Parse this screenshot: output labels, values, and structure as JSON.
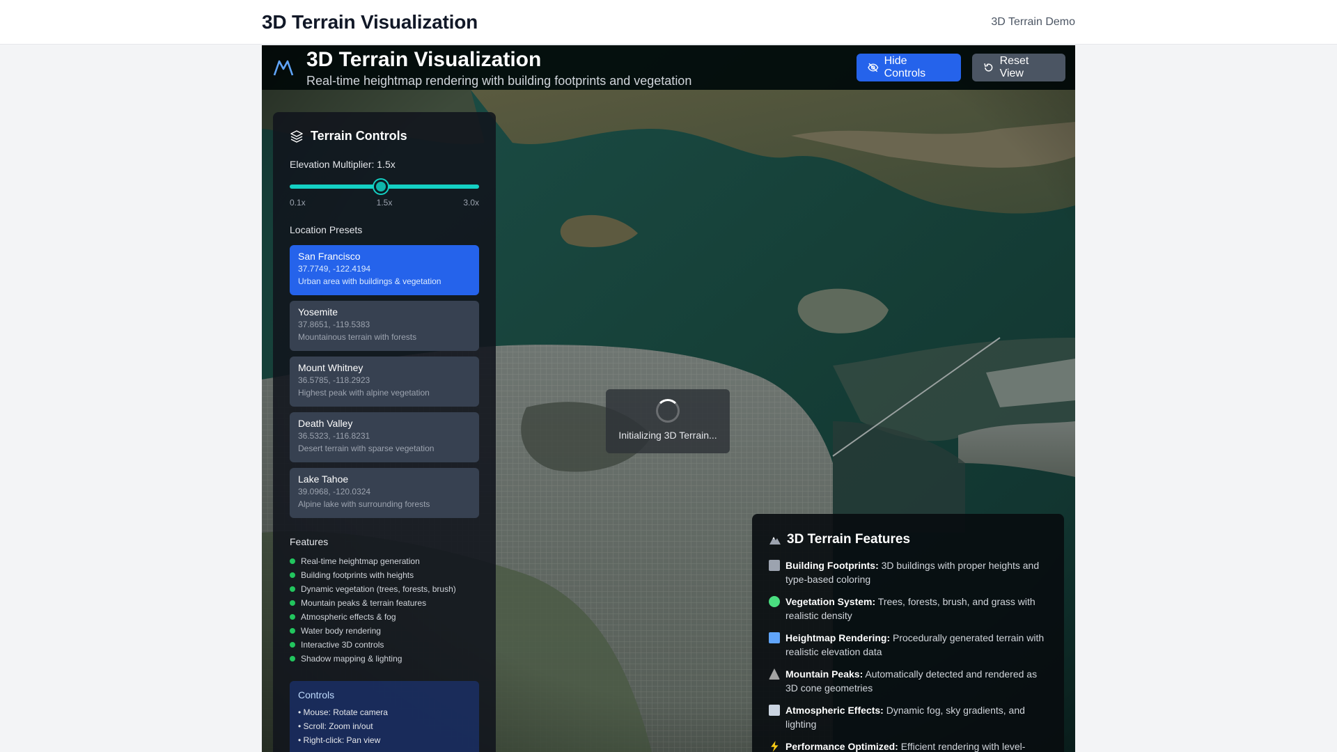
{
  "site": {
    "title": "3D Terrain Visualization",
    "nav_link": "3D Terrain Demo"
  },
  "app": {
    "title": "3D Terrain Visualization",
    "subtitle": "Real-time heightmap rendering with building footprints and vegetation",
    "hide_controls_label": "Hide Controls",
    "reset_view_label": "Reset View"
  },
  "controls": {
    "title": "Terrain Controls",
    "elevation_label": "Elevation Multiplier: 1.5x",
    "slider": {
      "value": 1.5,
      "min": 0.1,
      "max": 3.0,
      "tick_min": "0.1x",
      "tick_mid": "1.5x",
      "tick_max": "3.0x"
    },
    "presets_title": "Location Presets",
    "presets": [
      {
        "name": "San Francisco",
        "coords": "37.7749, -122.4194",
        "desc": "Urban area with buildings & vegetation",
        "active": true
      },
      {
        "name": "Yosemite",
        "coords": "37.8651, -119.5383",
        "desc": "Mountainous terrain with forests",
        "active": false
      },
      {
        "name": "Mount Whitney",
        "coords": "36.5785, -118.2923",
        "desc": "Highest peak with alpine vegetation",
        "active": false
      },
      {
        "name": "Death Valley",
        "coords": "36.5323, -116.8231",
        "desc": "Desert terrain with sparse vegetation",
        "active": false
      },
      {
        "name": "Lake Tahoe",
        "coords": "39.0968, -120.0324",
        "desc": "Alpine lake with surrounding forests",
        "active": false
      }
    ],
    "features_title": "Features",
    "features": [
      "Real-time heightmap generation",
      "Building footprints with heights",
      "Dynamic vegetation (trees, forests, brush)",
      "Mountain peaks & terrain features",
      "Atmospheric effects & fog",
      "Water body rendering",
      "Interactive 3D controls",
      "Shadow mapping & lighting"
    ],
    "help_title": "Controls",
    "help_items": [
      "• Mouse: Rotate camera",
      "• Scroll: Zoom in/out",
      "• Right-click: Pan view"
    ]
  },
  "loading": {
    "text": "Initializing 3D Terrain..."
  },
  "features_card": {
    "title": "3D Terrain Features",
    "items": [
      {
        "label": "Building Footprints:",
        "text": " 3D buildings with proper heights and type-based coloring",
        "icon": "building-icon",
        "color": "#9ca3af"
      },
      {
        "label": "Vegetation System:",
        "text": " Trees, forests, brush, and grass with realistic density",
        "icon": "tree-icon",
        "color": "#4ade80"
      },
      {
        "label": "Heightmap Rendering:",
        "text": " Procedurally generated terrain with realistic elevation data",
        "icon": "map-icon",
        "color": "#60a5fa"
      },
      {
        "label": "Mountain Peaks:",
        "text": " Automatically detected and rendered as 3D cone geometries",
        "icon": "mountain-icon",
        "color": "#a3a3a3"
      },
      {
        "label": "Atmospheric Effects:",
        "text": " Dynamic fog, sky gradients, and lighting",
        "icon": "fog-icon",
        "color": "#cbd5e1"
      },
      {
        "label": "Performance Optimized:",
        "text": " Efficient rendering with level-",
        "icon": "lightning-icon",
        "color": "#facc15"
      }
    ]
  },
  "colors": {
    "accent": "#2563eb",
    "slider": "#14d1c4",
    "feature_dot": "#22c55e",
    "water": "#1f5b4f"
  }
}
